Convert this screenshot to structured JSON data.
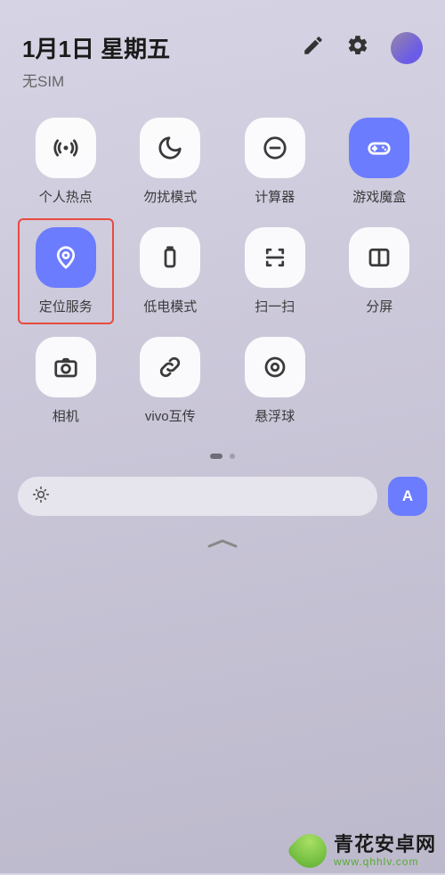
{
  "header": {
    "date": "1月1日 星期五",
    "sim": "无SIM"
  },
  "tiles": {
    "hotspot": {
      "label": "个人热点",
      "icon": "hotspot-icon",
      "active": false
    },
    "dnd": {
      "label": "勿扰模式",
      "icon": "moon-icon",
      "active": false
    },
    "calculator": {
      "label": "计算器",
      "icon": "calculator-icon",
      "active": false
    },
    "gamebox": {
      "label": "游戏魔盒",
      "icon": "gamepad-icon",
      "active": true
    },
    "location": {
      "label": "定位服务",
      "icon": "location-icon",
      "active": true,
      "highlighted": true
    },
    "lowpower": {
      "label": "低电模式",
      "icon": "battery-icon",
      "active": false
    },
    "scan": {
      "label": "扫一扫",
      "icon": "scan-icon",
      "active": false
    },
    "split": {
      "label": "分屏",
      "icon": "split-icon",
      "active": false
    },
    "camera": {
      "label": "相机",
      "icon": "camera-icon",
      "active": false
    },
    "vivoshare": {
      "label": "vivo互传",
      "icon": "link-icon",
      "active": false
    },
    "float": {
      "label": "悬浮球",
      "icon": "target-icon",
      "active": false
    }
  },
  "brightness": {
    "auto_label": "A"
  },
  "watermark": {
    "title": "青花安卓网",
    "url": "www.qhhlv.com"
  }
}
